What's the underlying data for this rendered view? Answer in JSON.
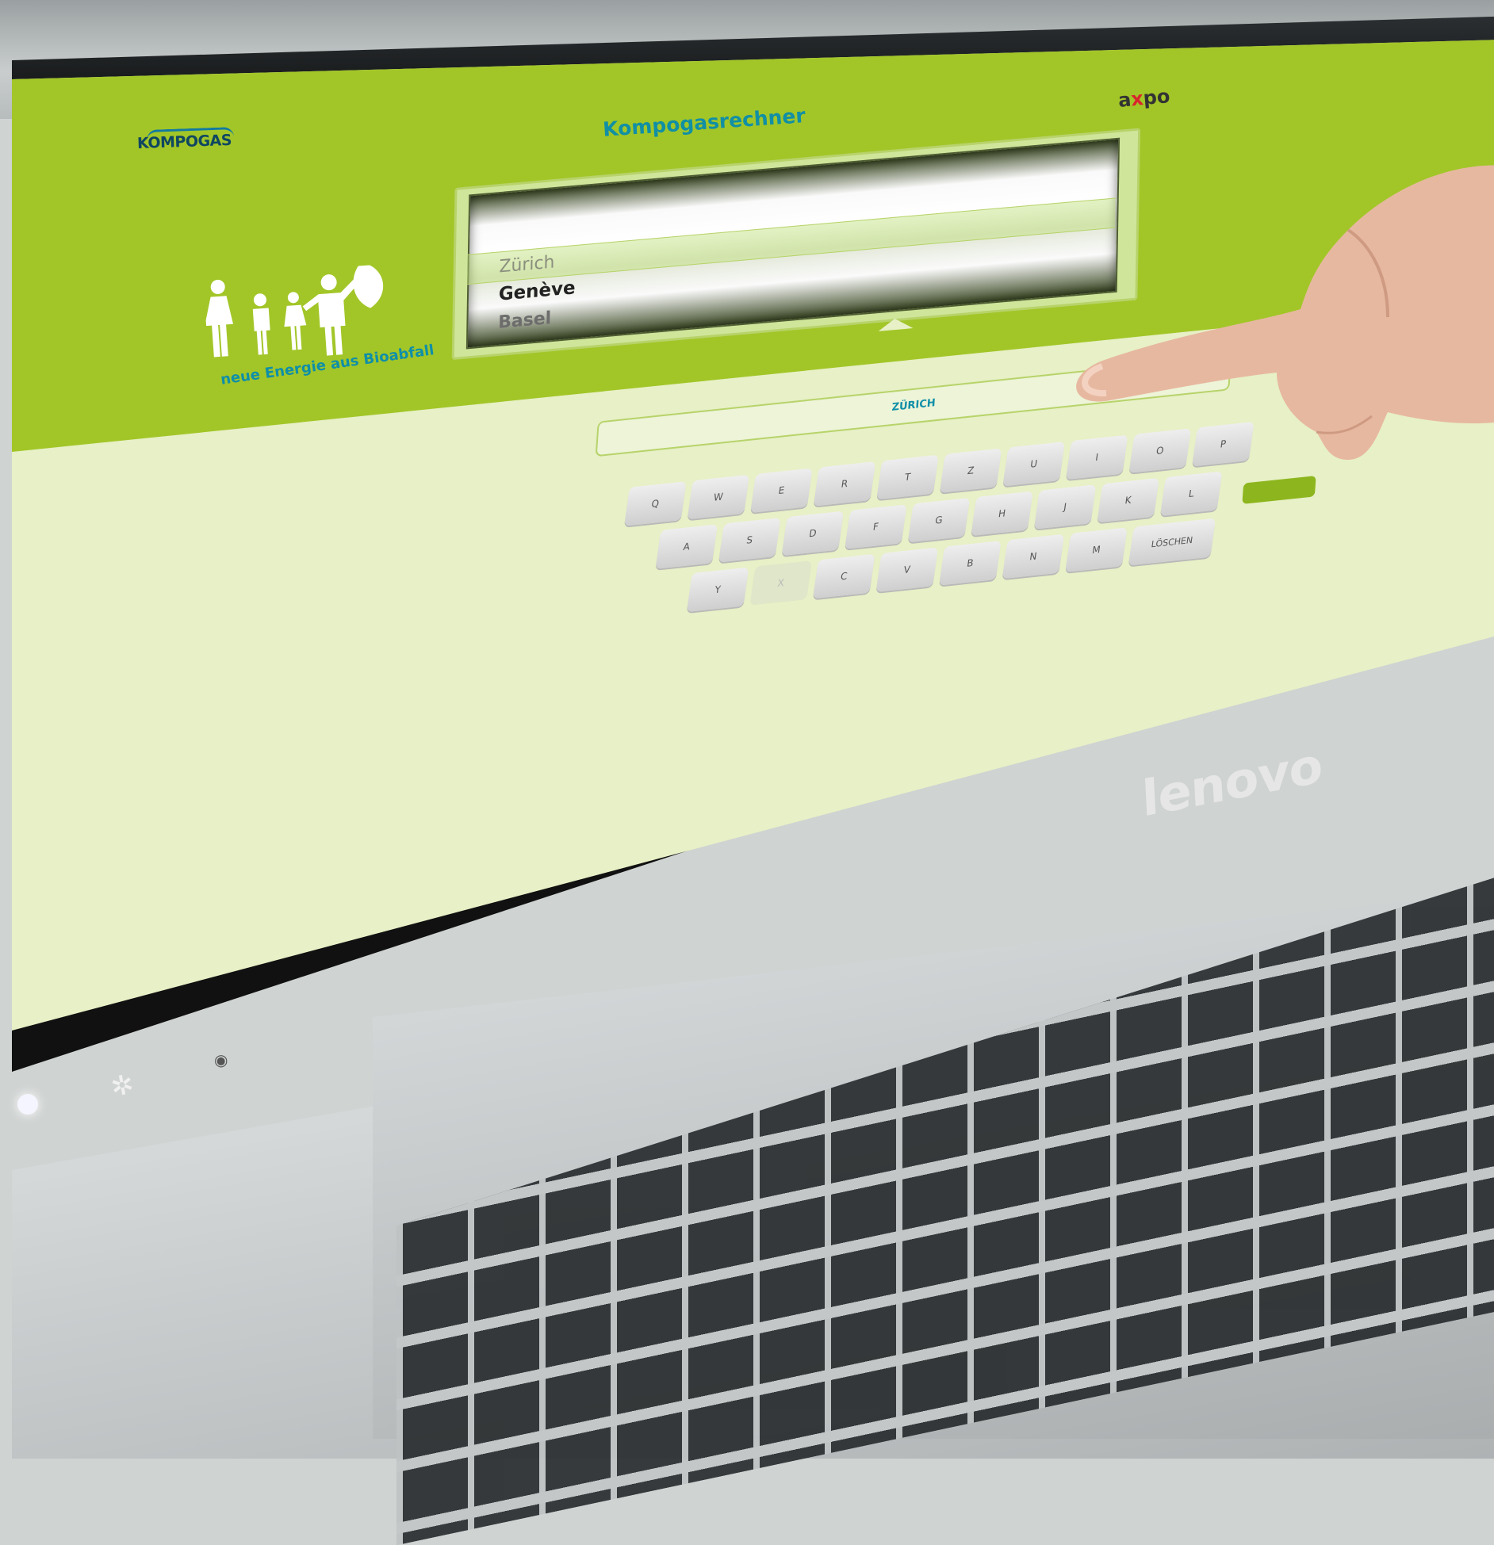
{
  "device": {
    "brand": "lenovo"
  },
  "app": {
    "logo_left": "KOMPOGAS",
    "title": "Kompogasrechner",
    "logo_right_a": "a",
    "logo_right_x": "x",
    "logo_right_po": "po",
    "tagline": "neue Energie aus Bioabfall"
  },
  "picker": {
    "items": [
      "Zürich",
      "Genève",
      "Basel"
    ],
    "selected": "Genève"
  },
  "input": {
    "value": "ZÜRICH"
  },
  "keyboard": {
    "row1": [
      "Q",
      "W",
      "E",
      "R",
      "T",
      "Z",
      "U",
      "I",
      "O",
      "P"
    ],
    "row2": [
      "A",
      "S",
      "D",
      "F",
      "G",
      "H",
      "J",
      "K",
      "L"
    ],
    "row3": [
      "Y",
      "X",
      "C",
      "V",
      "B",
      "N",
      "M",
      "LÖSCHEN"
    ]
  },
  "colors": {
    "header_green": "#a2c628",
    "screen_bg": "#e7f0c6",
    "title_teal": "#118fa5",
    "axpo_red": "#d8262d"
  },
  "icons": {
    "family": "family-with-leaf-icon",
    "camera": "camera-icon"
  }
}
